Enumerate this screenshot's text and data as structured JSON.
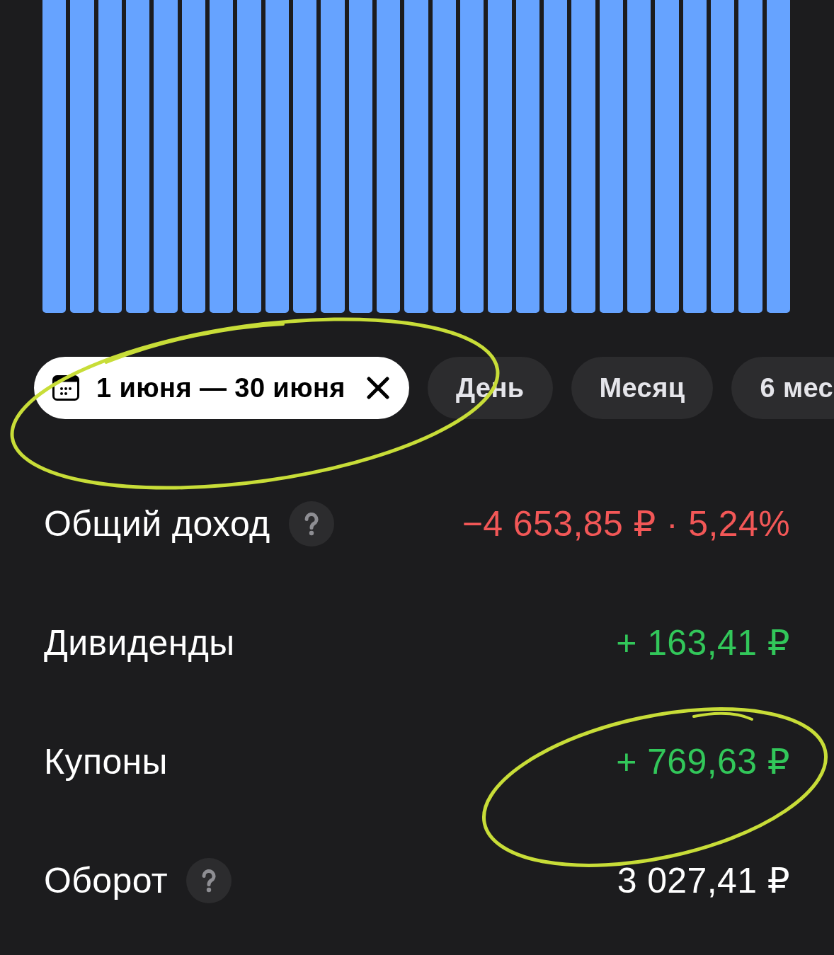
{
  "period_chips": [
    {
      "kind": "range",
      "label": "1 июня — 30 июня",
      "selected": true
    },
    {
      "kind": "preset",
      "label": "День",
      "selected": false
    },
    {
      "kind": "preset",
      "label": "Месяц",
      "selected": false
    },
    {
      "kind": "preset",
      "label": "6 мес",
      "selected": false
    }
  ],
  "summary_rows": [
    {
      "label": "Общий доход",
      "has_help": true,
      "value": "−4 653,85 ₽ · 5,24%",
      "color": "#f25757"
    },
    {
      "label": "Дивиденды",
      "has_help": false,
      "value": "+ 163,41 ₽",
      "color": "#32c75a"
    },
    {
      "label": "Купоны",
      "has_help": false,
      "value": "+ 769,63 ₽",
      "color": "#32c75a"
    },
    {
      "label": "Оборот",
      "has_help": true,
      "value": "3 027,41 ₽",
      "color": "#ffffff"
    }
  ]
}
